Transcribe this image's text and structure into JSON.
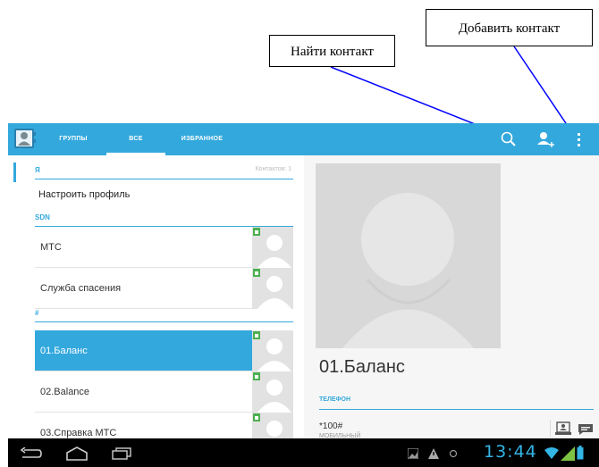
{
  "callouts": {
    "find_contact": "Найти  контакт",
    "add_contact": "Добавить контакт"
  },
  "tabs": [
    {
      "label": "ГРУППЫ"
    },
    {
      "label": "ВСЕ"
    },
    {
      "label": "ИЗБРАННОЕ"
    }
  ],
  "contacts": {
    "me_header": "Я",
    "count_label": "Контактов: 1",
    "setup_profile": "Настроить профиль",
    "sdn_header": "SDN",
    "sdn_items": [
      "МТС",
      "Служба спасения"
    ],
    "hash_header": "#",
    "items": [
      "01.Баланс",
      "02.Balance",
      "03.Справка МТС"
    ]
  },
  "detail": {
    "name": "01.Баланс",
    "phone_header": "ТЕЛЕФОН",
    "number": "*100#",
    "type": "МОБИЛЬНЫЙ"
  },
  "status": {
    "time": "13:44"
  },
  "colors": {
    "accent": "#33a8dd",
    "clock": "#33b5e5",
    "signal": "#7dc242"
  },
  "icons": {
    "search": "search-icon",
    "add_contact": "add-contact-icon",
    "overflow": "overflow-menu-icon",
    "back": "back-icon",
    "home": "home-icon",
    "recent": "recent-apps-icon"
  }
}
